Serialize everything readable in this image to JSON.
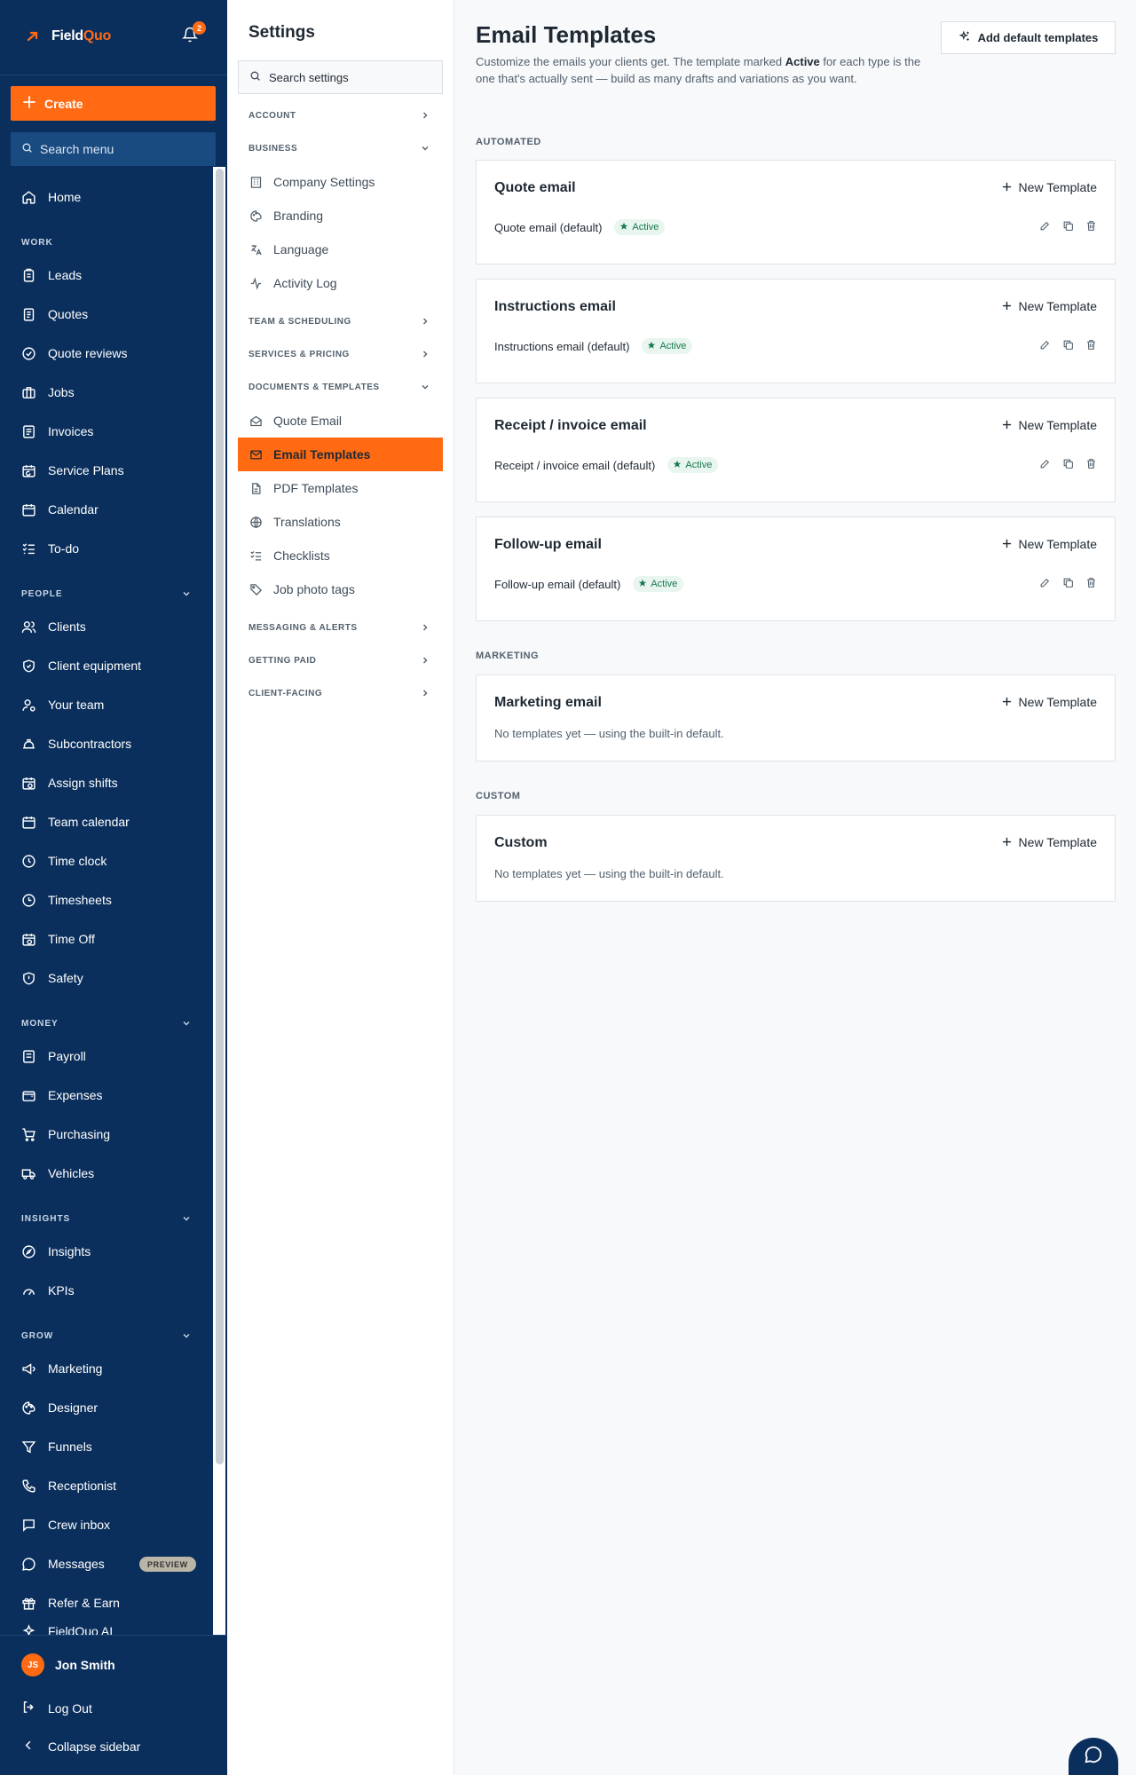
{
  "brand": {
    "name_part1": "Field",
    "name_part2": "Quo",
    "notification_count": "2"
  },
  "nav": {
    "create_label": "Create",
    "search_placeholder": "Search menu",
    "home": "Home",
    "sections": [
      {
        "title": "WORK",
        "items": [
          "Leads",
          "Quotes",
          "Quote reviews",
          "Jobs",
          "Invoices",
          "Service Plans",
          "Calendar",
          "To-do"
        ]
      },
      {
        "title": "PEOPLE",
        "items": [
          "Clients",
          "Client equipment",
          "Your team",
          "Subcontractors",
          "Assign shifts",
          "Team calendar",
          "Time clock",
          "Timesheets",
          "Time Off",
          "Safety"
        ]
      },
      {
        "title": "MONEY",
        "items": [
          "Payroll",
          "Expenses",
          "Purchasing",
          "Vehicles"
        ]
      },
      {
        "title": "INSIGHTS",
        "items": [
          "Insights",
          "KPIs"
        ]
      },
      {
        "title": "GROW",
        "items": [
          "Marketing",
          "Designer",
          "Funnels",
          "Receptionist",
          "Crew inbox",
          "Messages",
          "Refer & Earn"
        ]
      }
    ],
    "messages_pill": "PREVIEW",
    "partial_item": "FieldQuo AI",
    "user_initials": "JS",
    "user_name": "Jon Smith",
    "logout": "Log Out",
    "collapse": "Collapse sidebar"
  },
  "settings": {
    "title": "Settings",
    "search_placeholder": "Search settings",
    "groups": {
      "account": "ACCOUNT",
      "business": "BUSINESS",
      "team": "TEAM & SCHEDULING",
      "services": "SERVICES & PRICING",
      "documents": "DOCUMENTS & TEMPLATES",
      "messaging": "MESSAGING & ALERTS",
      "getting_paid": "GETTING PAID",
      "client_facing": "CLIENT-FACING"
    },
    "business_items": [
      "Company Settings",
      "Branding",
      "Language",
      "Activity Log"
    ],
    "documents_items": [
      "Quote Email",
      "Email Templates",
      "PDF Templates",
      "Translations",
      "Checklists",
      "Job photo tags"
    ]
  },
  "main": {
    "title": "Email Templates",
    "desc_before": "Customize the emails your clients get. The template marked ",
    "desc_bold": "Active",
    "desc_after": " for each type is the one that's actually sent — build as many drafts and variations as you want.",
    "add_defaults_label": "Add default templates",
    "new_template_label": "New Template",
    "active_label": "Active",
    "empty_text": "No templates yet — using the built-in default.",
    "sections": {
      "automated": "AUTOMATED",
      "marketing": "MARKETING",
      "custom": "CUSTOM"
    },
    "cards": {
      "quote": {
        "title": "Quote email",
        "template": "Quote email (default)"
      },
      "instructions": {
        "title": "Instructions email",
        "template": "Instructions email (default)"
      },
      "receipt": {
        "title": "Receipt / invoice email",
        "template": "Receipt / invoice email (default)"
      },
      "followup": {
        "title": "Follow-up email",
        "template": "Follow-up email (default)"
      },
      "marketing": {
        "title": "Marketing email"
      },
      "custom": {
        "title": "Custom"
      }
    }
  },
  "colors": {
    "nav_bg": "#0b2f5c",
    "accent": "#ff6a13",
    "active_badge": "#17794d"
  }
}
